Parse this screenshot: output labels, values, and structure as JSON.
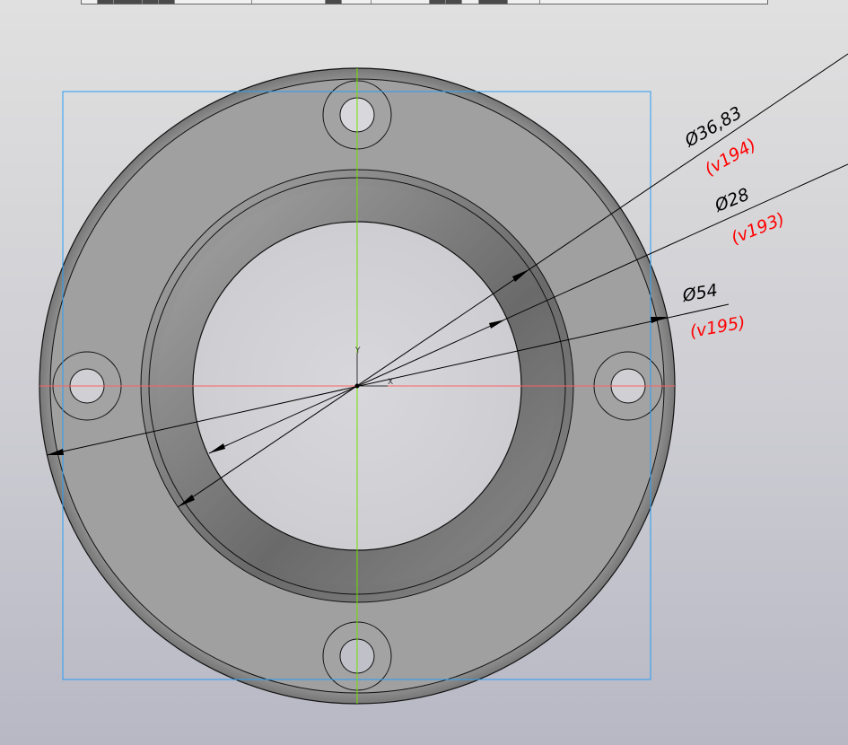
{
  "view": {
    "dimensions": [
      {
        "label": "Ø36,83",
        "variable": "(v194)"
      },
      {
        "label": "Ø28",
        "variable": "(v193)"
      },
      {
        "label": "Ø54",
        "variable": "(v195)"
      }
    ],
    "axes": {
      "x_label": "X",
      "y_label": "Y"
    },
    "colors": {
      "selection_box": "#2a9df4",
      "x_axis": "#ff6060",
      "y_axis": "#70e000",
      "variable": "#ff0000"
    }
  }
}
